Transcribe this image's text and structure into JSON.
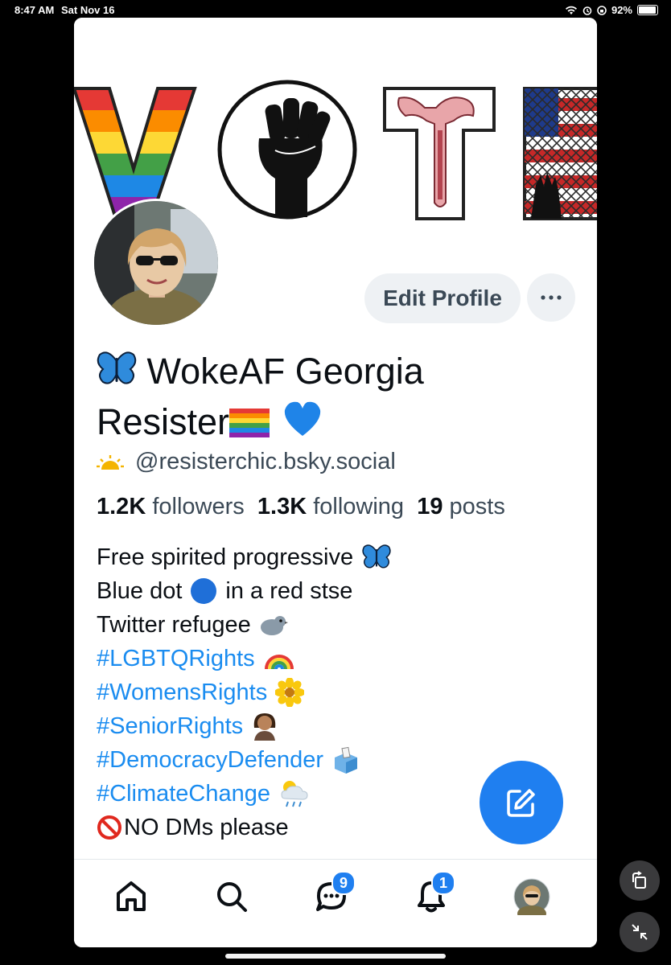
{
  "status": {
    "time": "8:47 AM",
    "date": "Sat Nov 16",
    "battery": "92%"
  },
  "profile": {
    "edit_label": "Edit Profile",
    "more_label": "···",
    "name_line1": "WokeAF Georgia",
    "name_line2": "Resister",
    "handle": "@resisterchic.bsky.social",
    "followers_count": "1.2K",
    "followers_label": "followers",
    "following_count": "1.3K",
    "following_label": "following",
    "posts_count": "19",
    "posts_label": "posts"
  },
  "bio": {
    "line1": "Free spirited progressive",
    "line2a": "Blue dot",
    "line2b": "in a red stse",
    "line3": "Twitter refugee",
    "tag1": "#LGBTQRights",
    "tag2": "#WomensRights",
    "tag3": "#SeniorRights",
    "tag4": "#DemocracyDefender",
    "tag5": "#ClimateChange",
    "last": "NO DMs please"
  },
  "tabs": {
    "messages_badge": "9",
    "notifications_badge": "1"
  },
  "colors": {
    "accent": "#1f7ff0",
    "tag": "#1a8cf0"
  }
}
